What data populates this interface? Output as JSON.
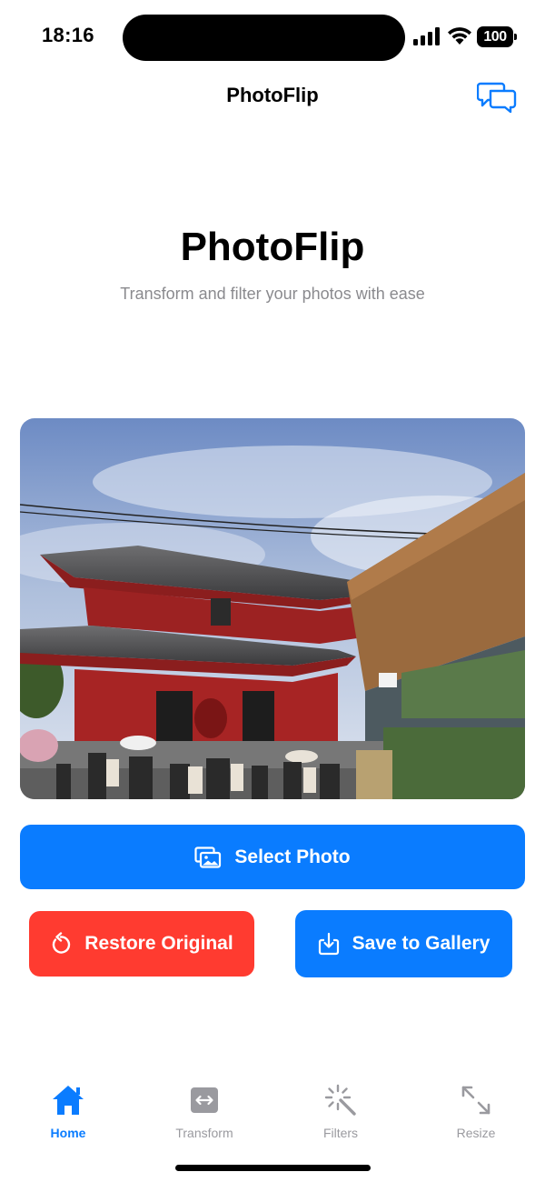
{
  "status_bar": {
    "time": "18:16",
    "battery": "100",
    "icons": [
      "signal-icon",
      "wifi-icon",
      "battery-icon"
    ]
  },
  "nav": {
    "title": "PhotoFlip",
    "chat_icon": "chat-bubbles-icon"
  },
  "hero": {
    "title": "PhotoFlip",
    "subtitle": "Transform and filter your photos with ease"
  },
  "photo": {
    "subject": "photo-preview"
  },
  "buttons": {
    "select_photo": "Select Photo",
    "restore_original": "Restore Original",
    "save_to_gallery": "Save to Gallery"
  },
  "tabs": [
    {
      "label": "Home",
      "icon": "house-icon",
      "active": true
    },
    {
      "label": "Transform",
      "icon": "transform-icon",
      "active": false
    },
    {
      "label": "Filters",
      "icon": "magic-wand-icon",
      "active": false
    },
    {
      "label": "Resize",
      "icon": "resize-arrows-icon",
      "active": false
    }
  ],
  "colors": {
    "accent": "#0a7cff",
    "destructive": "#ff3b30",
    "inactive_tab": "#9a9a9f",
    "subtitle": "#8a8a8e"
  }
}
